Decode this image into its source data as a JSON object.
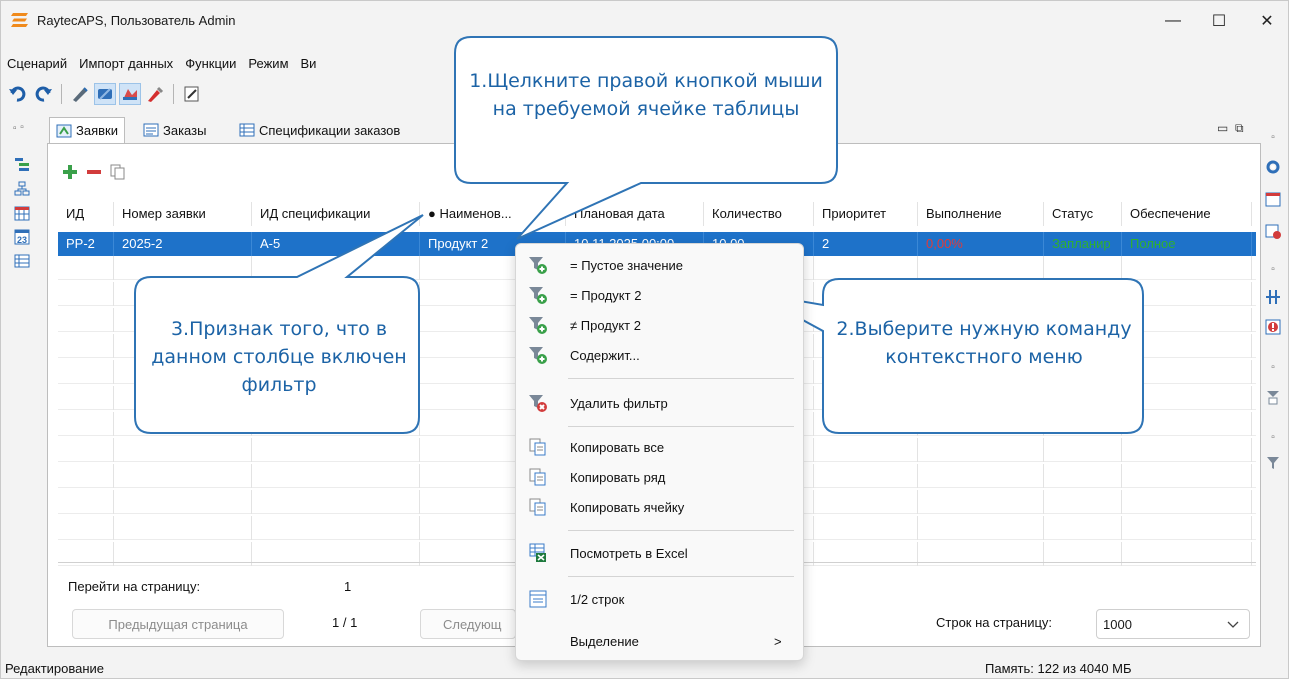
{
  "window": {
    "title": "RaytecAPS, Пользователь Admin",
    "controls": {
      "minimize": "—",
      "maximize": "☐",
      "close": "✕"
    }
  },
  "menu": [
    "Сценарий",
    "Импорт данных",
    "Функции",
    "Режим",
    "Ви"
  ],
  "tabs": [
    {
      "label": "Заявки",
      "active": true
    },
    {
      "label": "Заказы",
      "active": false
    },
    {
      "label": "Спецификации заказов",
      "active": false
    }
  ],
  "grid": {
    "columns": [
      "ИД",
      "Номер заявки",
      "ИД спецификации",
      "● Наименов...",
      "Плановая дата",
      "Количество",
      "Приоритет",
      "Выполнение",
      "Статус",
      "Обеспечение"
    ],
    "rows": [
      [
        "PP-2",
        "2025-2",
        "A-5",
        "Продукт 2",
        "10.11.2025 00:00",
        "10,00",
        "2",
        "0,00%",
        "Запланир",
        "Полное"
      ]
    ],
    "status_colors": {
      "execution": "#e03b3b",
      "status": "#2fb02f",
      "supply": "#2fb02f"
    }
  },
  "pager": {
    "goto_label": "Перейти на страницу:",
    "page_value": "1",
    "prev_label": "Предыдущая страница",
    "page_counter": "1 / 1",
    "next_label": "Следующ",
    "per_page_label": "Строк на страницу:",
    "per_page_value": "1000"
  },
  "status": {
    "left": "Редактирование",
    "memory": "Память: 122 из 4040 МБ"
  },
  "context_menu": {
    "items": [
      {
        "label": "= Пустое значение",
        "icon": "filter-add-icon"
      },
      {
        "label": "= Продукт 2",
        "icon": "filter-add-icon"
      },
      {
        "label": "≠ Продукт 2",
        "icon": "filter-add-icon"
      },
      {
        "label": "Содержит...",
        "icon": "filter-add-icon"
      },
      {
        "label": "Удалить фильтр",
        "icon": "filter-remove-icon"
      },
      {
        "label": "Копировать все",
        "icon": "copy-icon"
      },
      {
        "label": "Копировать ряд",
        "icon": "copy-icon"
      },
      {
        "label": "Копировать ячейку",
        "icon": "copy-icon"
      },
      {
        "label": "Посмотреть в Excel",
        "icon": "excel-icon"
      },
      {
        "label": "1/2 строк",
        "icon": "table-icon"
      },
      {
        "label": "Выделение",
        "icon": "",
        "submenu_arrow": ">"
      }
    ]
  },
  "callouts": {
    "c1": "1.Щелкните правой кнопкой мыши на требуемой ячейке таблицы",
    "c2": "2.Выберите нужную команду контекстного меню",
    "c3": "3.Признак того, что в данном столбце включен фильтр"
  },
  "colors": {
    "accent": "#1e72c9",
    "callout_border": "#2f74b5",
    "callout_text": "#1c63a6"
  }
}
